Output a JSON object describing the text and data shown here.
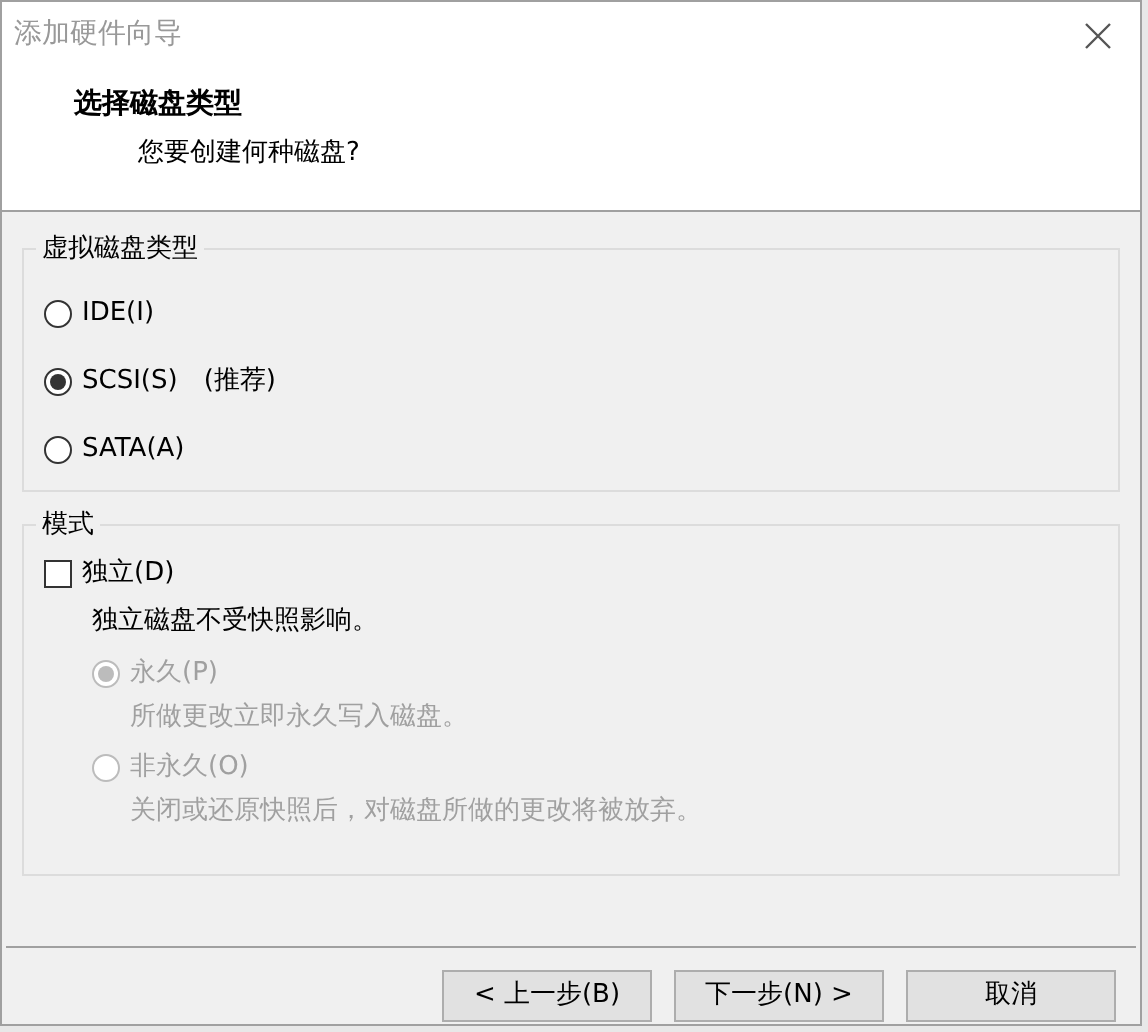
{
  "window": {
    "title": "添加硬件向导"
  },
  "header": {
    "title": "选择磁盘类型",
    "subtitle": "您要创建何种磁盘?"
  },
  "disk_type": {
    "legend": "虚拟磁盘类型",
    "options": [
      {
        "label": "IDE(I)",
        "selected": false
      },
      {
        "label": "SCSI(S)",
        "note": "(推荐)",
        "selected": true
      },
      {
        "label": "SATA(A)",
        "selected": false
      }
    ]
  },
  "mode": {
    "legend": "模式",
    "independent": {
      "label": "独立(D)",
      "checked": false,
      "description": "独立磁盘不受快照影响。"
    },
    "options": [
      {
        "label": "永久(P)",
        "description": "所做更改立即永久写入磁盘。",
        "selected": true,
        "disabled": true
      },
      {
        "label": "非永久(O)",
        "description": "关闭或还原快照后，对磁盘所做的更改将被放弃。",
        "selected": false,
        "disabled": true
      }
    ]
  },
  "buttons": [
    {
      "label": "< 上一步(B)"
    },
    {
      "label": "下一步(N) >"
    },
    {
      "label": "取消"
    }
  ]
}
